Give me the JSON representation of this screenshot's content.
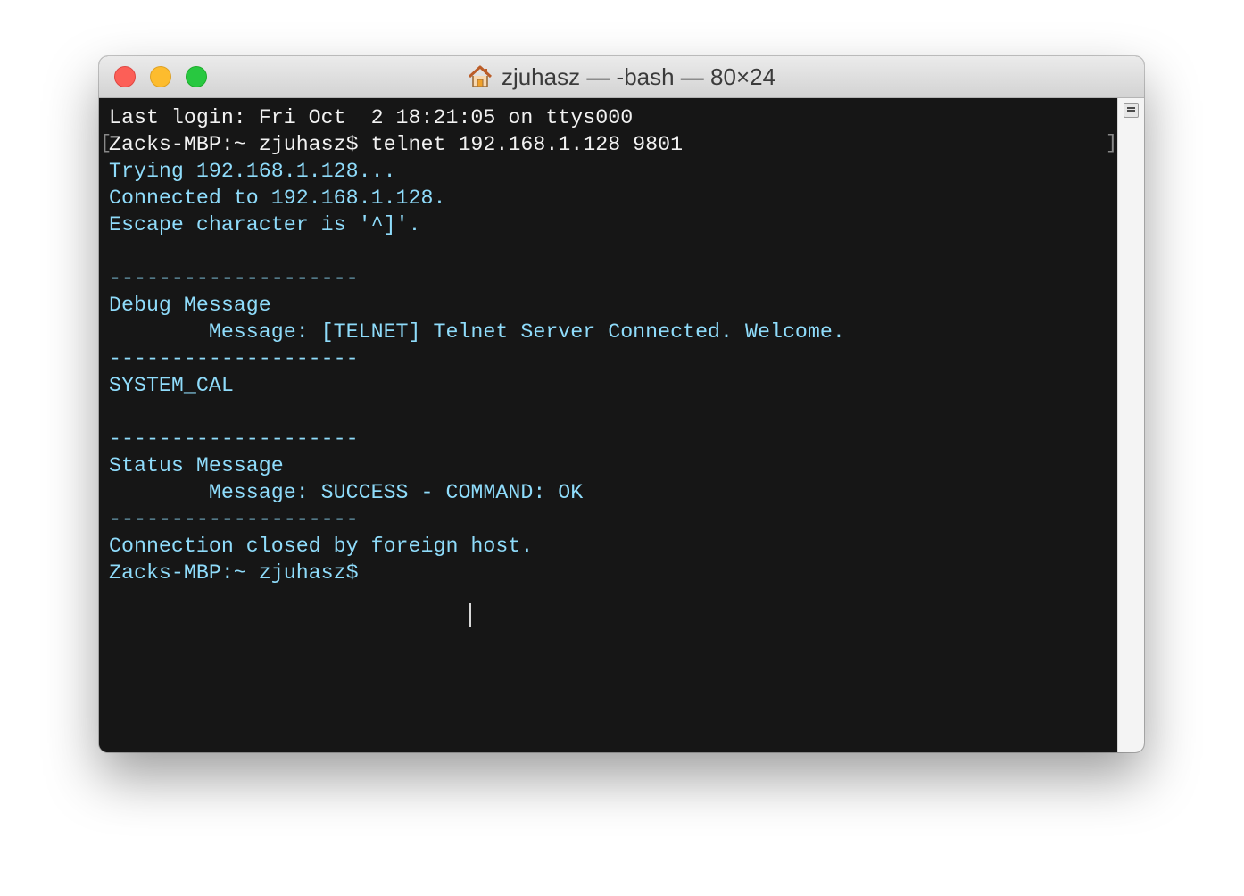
{
  "window": {
    "title": "zjuhasz — -bash — 80×24",
    "title_icon": "home-icon",
    "controls": {
      "close": "close-window-button",
      "minimize": "minimize-window-button",
      "zoom": "zoom-window-button"
    },
    "colors": {
      "close": "#fc5f57",
      "minimize": "#fdbc2e",
      "zoom": "#28c840",
      "terminal_background": "#161616",
      "terminal_text": "#8fdcfb"
    }
  },
  "terminal": {
    "lines": [
      "Last login: Fri Oct  2 18:21:05 on ttys000",
      "Zacks-MBP:~ zjuhasz$ telnet 192.168.1.128 9801",
      "Trying 192.168.1.128...",
      "Connected to 192.168.1.128.",
      "Escape character is '^]'.",
      "",
      "--------------------",
      "Debug Message",
      "        Message: [TELNET] Telnet Server Connected. Welcome.",
      "--------------------",
      "SYSTEM_CAL",
      "",
      "--------------------",
      "Status Message",
      "        Message: SUCCESS - COMMAND: OK",
      "--------------------",
      "Connection closed by foreign host.",
      "Zacks-MBP:~ zjuhasz$ "
    ]
  },
  "scrollbar": {
    "button_icon": "scroll-lines-icon"
  }
}
